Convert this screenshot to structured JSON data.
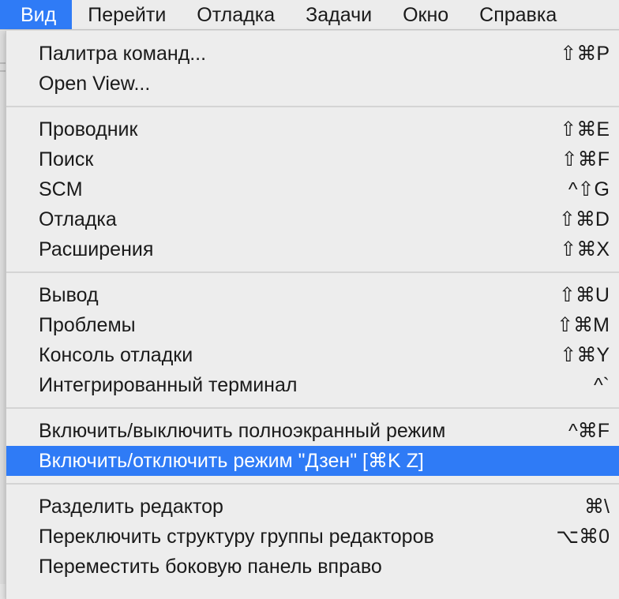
{
  "menubar": {
    "items": [
      {
        "label": "Вид",
        "active": true
      },
      {
        "label": "Перейти"
      },
      {
        "label": "Отладка"
      },
      {
        "label": "Задачи"
      },
      {
        "label": "Окно"
      },
      {
        "label": "Справка"
      }
    ]
  },
  "menu": {
    "groups": [
      [
        {
          "label": "Палитра команд...",
          "shortcut": "⇧⌘P"
        },
        {
          "label": "Open View...",
          "shortcut": ""
        }
      ],
      [
        {
          "label": "Проводник",
          "shortcut": "⇧⌘E"
        },
        {
          "label": "Поиск",
          "shortcut": "⇧⌘F"
        },
        {
          "label": "SCM",
          "shortcut": "^⇧G"
        },
        {
          "label": "Отладка",
          "shortcut": "⇧⌘D"
        },
        {
          "label": "Расширения",
          "shortcut": "⇧⌘X"
        }
      ],
      [
        {
          "label": "Вывод",
          "shortcut": "⇧⌘U"
        },
        {
          "label": "Проблемы",
          "shortcut": "⇧⌘M"
        },
        {
          "label": "Консоль отладки",
          "shortcut": "⇧⌘Y"
        },
        {
          "label": "Интегрированный терминал",
          "shortcut": "^`"
        }
      ],
      [
        {
          "label": "Включить/выключить полноэкранный режим",
          "shortcut": "^⌘F"
        },
        {
          "label": "Включить/отключить режим \"Дзен\" [⌘K Z]",
          "shortcut": "",
          "highlighted": true
        }
      ],
      [
        {
          "label": "Разделить редактор",
          "shortcut": "⌘\\"
        },
        {
          "label": "Переключить структуру группы редакторов",
          "shortcut": "⌥⌘0"
        },
        {
          "label": "Переместить боковую панель вправо",
          "shortcut": ""
        }
      ]
    ]
  }
}
